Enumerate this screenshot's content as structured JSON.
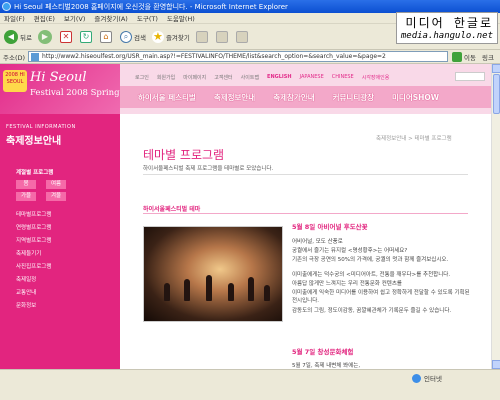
{
  "window": {
    "title": "Hi Seoul 페스티벌2008 홈페이지에 오신것을 환영합니다. - Microsoft Internet Explorer"
  },
  "watermark": {
    "ko": "미디어 한글로",
    "en": "media.hangulo.net"
  },
  "menubar": [
    "파일(F)",
    "편집(E)",
    "보기(V)",
    "즐겨찾기(A)",
    "도구(T)",
    "도움말(H)"
  ],
  "toolbar": {
    "back": "뒤로",
    "search": "검색",
    "favorites": "즐겨찾기"
  },
  "address": {
    "label": "주소(D)",
    "url": "http://www2.hiseoulfest.org/USR_main.asp?!=FESTIVALINFO/THEME/list&search_option=&search_value=&page=2",
    "go": "이동",
    "links": "링크"
  },
  "site": {
    "logo": {
      "badge": "2008 HI SEOUL",
      "name": "Hi Seoul",
      "festival": "Festival 2008 Spring"
    },
    "util": [
      "로그인",
      "회원가입",
      "마이페이지",
      "고객센터",
      "사이트맵",
      "ENGLISH",
      "JAPANESE",
      "CHINESE",
      "시각장애인용"
    ],
    "gnb": [
      "하이서울 페스티벌",
      "축제정보안내",
      "축제참가안내",
      "커뮤니티광장",
      "미디어SHOW"
    ],
    "lnb": {
      "eyebrow": "FESTIVAL INFORMATION",
      "heading": "축제정보안내",
      "section": "계절별 프로그램",
      "seasons": [
        "봄",
        "여름",
        "가을",
        "겨울"
      ],
      "items": [
        "테마별프로그램",
        "연령별프로그램",
        "지역별프로그램",
        "축제둘기기",
        "사진집프로그램",
        "축제일정",
        "교통안내",
        "문화정보"
      ]
    },
    "breadcrumb": "축제정보안내 > 테마별 프로그램",
    "page_title": "테마별 프로그램",
    "page_desc": "하이서울페스티벌 축제 프로그램을 테마별로 모았습니다.",
    "section_title": "하이서울페스티벌 테마",
    "event1": {
      "date": "5월 8일 아비어널 후도산꽃",
      "lines": [
        "어비어널, 모도 산풍로",
        "궁궐에서 즐기는 뮤지컬 <명성황후>는 어떠세요?",
        "기존의 극장 공연의 50%의 가격에, 궁궐의 멋과 함께 즐겨보십시오.",
        "",
        "이미출에게는 덕수궁의 <미디어아트, 전통을 깨우다>를 추천합니다.",
        "아름답 않게만 느껴지는 우리 전통문화 컨텐츠를",
        "이미출에게 익숙한 미디어를 이용하여 쉽고 정확하게 전달할 수 있도록 기획된 전시입니다.",
        "감동도의 그림, 정도이감동, 꿈깔혜관체가 기록문두 즐길 수 있습니다."
      ]
    },
    "event2": {
      "date": "5월 7일 창성문화체험",
      "line": "5월 7일, 축제 내변체 봐에는,"
    }
  },
  "status": {
    "zone": "인터넷"
  }
}
